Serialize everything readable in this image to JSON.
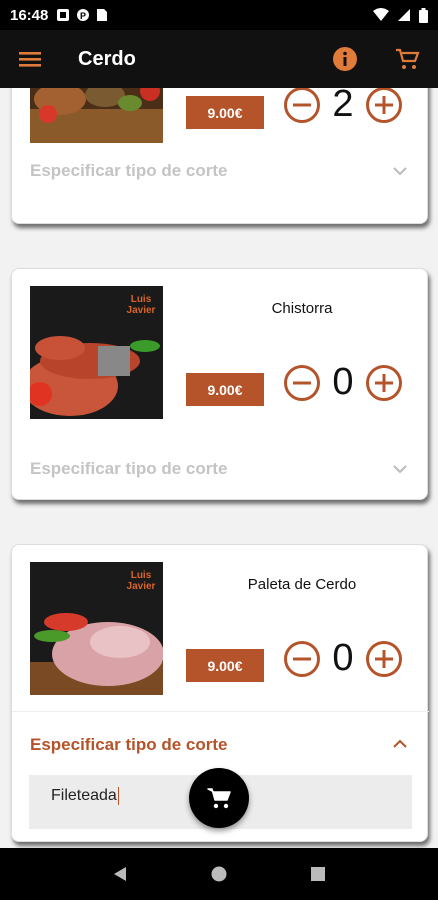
{
  "status_bar": {
    "time": "16:48"
  },
  "app_bar": {
    "title": "Cerdo"
  },
  "colors": {
    "accent": "#b5542a",
    "appbar_bg": "#111111"
  },
  "products": [
    {
      "name": "",
      "price": "9.00€",
      "quantity": "2",
      "cut_label": "Especificar tipo de corte",
      "expanded": false
    },
    {
      "name": "Chistorra",
      "price": "9.00€",
      "quantity": "0",
      "cut_label": "Especificar tipo de corte",
      "expanded": false,
      "image_brand": "Luis Javier"
    },
    {
      "name": "Paleta de Cerdo",
      "price": "9.00€",
      "quantity": "0",
      "cut_label": "Especificar tipo de corte",
      "expanded": true,
      "cut_value": "Fileteada",
      "image_brand": "Luis Javier"
    }
  ],
  "icons": {
    "menu": "menu-icon",
    "info": "info-icon",
    "cart": "cart-icon",
    "fab": "cart-icon"
  }
}
